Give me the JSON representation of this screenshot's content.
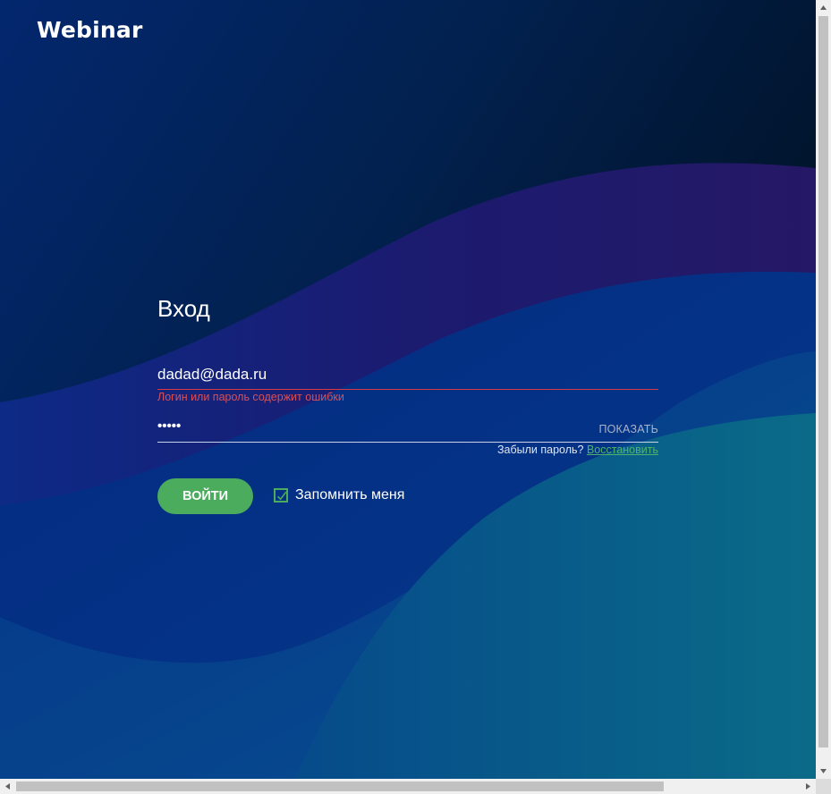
{
  "brand": {
    "logo_text": "Webinar"
  },
  "login_form": {
    "title": "Вход",
    "email_value": "dadad@dada.ru",
    "email_error": "Логин или пароль содержит ошибки",
    "password_masked": "•••••",
    "show_password_label": "ПОКАЗАТЬ",
    "forgot_label": "Забыли пароль?",
    "restore_link_label": "Восстановить",
    "submit_label": "ВОЙТИ",
    "remember_me_label": "Запомнить меня",
    "remember_me_checked": true
  },
  "colors": {
    "accent_green": "#4bac5d",
    "error_red": "#d63b45",
    "background_dark": "#021a3e",
    "wave_purple": "#1c1a6b",
    "wave_blue": "#03287a",
    "wave_teal": "#0a5a86"
  },
  "icons": {
    "checkbox": "checkmark-icon",
    "scroll_up": "triangle-up-icon",
    "scroll_down": "triangle-down-icon",
    "scroll_left": "triangle-left-icon",
    "scroll_right": "triangle-right-icon"
  }
}
